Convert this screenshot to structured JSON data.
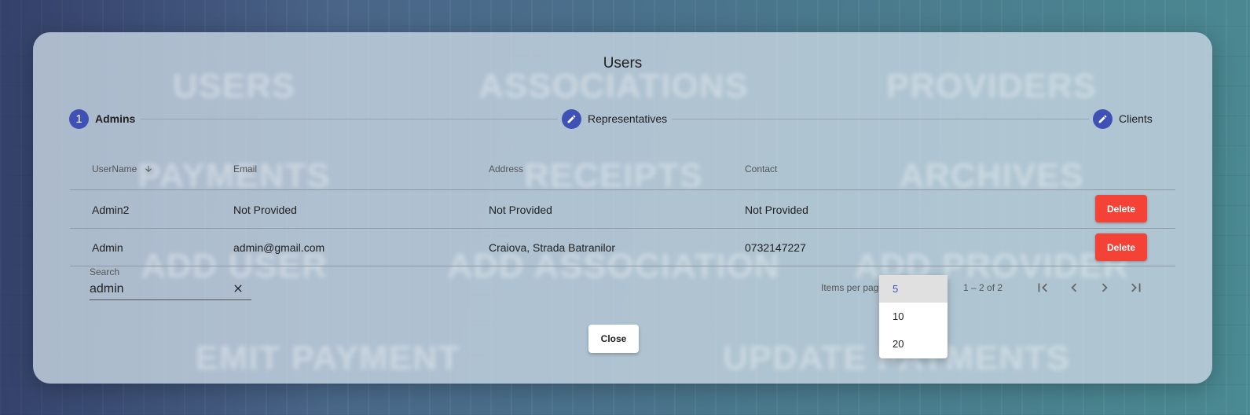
{
  "dialog": {
    "title": "Users",
    "background_tiles": [
      "USERS",
      "ASSOCIATIONS",
      "PROVIDERS",
      "PAYMENTS",
      "RECEIPTS",
      "ARCHIVES",
      "ADD USER",
      "ADD ASSOCIATION",
      "ADD PROVIDER",
      "EMIT PAYMENT",
      "UPDATE PAYMENTS"
    ]
  },
  "stepper": {
    "steps": [
      {
        "icon": "1",
        "label": "Admins",
        "state": "active"
      },
      {
        "icon": "pencil-icon",
        "label": "Representatives",
        "state": "edit"
      },
      {
        "icon": "pencil-icon",
        "label": "Clients",
        "state": "edit"
      }
    ]
  },
  "table": {
    "headers": {
      "username": "UserName",
      "email": "Email",
      "address": "Address",
      "contact": "Contact"
    },
    "sort": {
      "column": "username",
      "direction": "asc"
    },
    "rows": [
      {
        "username": "Admin2",
        "email": "Not Provided",
        "address": "Not Provided",
        "contact": "Not Provided",
        "action": "Delete"
      },
      {
        "username": "Admin",
        "email": "admin@gmail.com",
        "address": "Craiova, Strada Batranilor",
        "contact": "0732147227",
        "action": "Delete"
      }
    ]
  },
  "search": {
    "label": "Search",
    "value": "admin"
  },
  "paginator": {
    "items_per_page_label": "Items per page:",
    "options": [
      "5",
      "10",
      "20"
    ],
    "selected": "5",
    "range_label": "1 – 2 of 2"
  },
  "footer": {
    "close_label": "Close"
  },
  "colors": {
    "primary": "#3f51b5",
    "danger": "#f44336"
  }
}
